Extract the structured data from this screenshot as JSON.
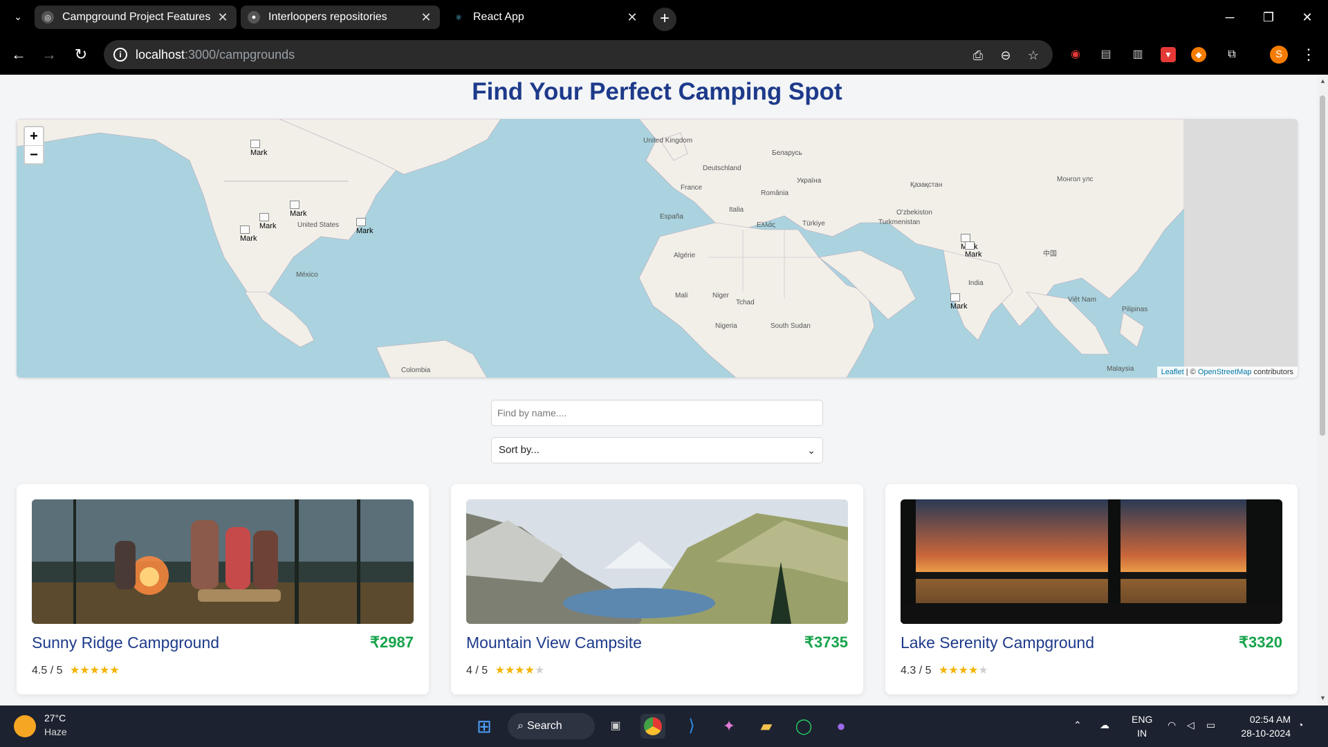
{
  "browser": {
    "tabs": [
      {
        "title": "Campground Project Features",
        "icon": "openai-icon"
      },
      {
        "title": "Interloopers repositories",
        "icon": "github-icon"
      },
      {
        "title": "React App",
        "icon": "react-icon"
      }
    ],
    "url_host": "localhost",
    "url_rest": ":3000/campgrounds",
    "profile_initial": "S"
  },
  "page": {
    "heading": "Find Your Perfect Camping Spot",
    "search_placeholder": "Find by name....",
    "sort_label": "Sort by..."
  },
  "map": {
    "zoom_in": "+",
    "zoom_out": "−",
    "marker_label": "Mark",
    "labels": [
      "United Kingdom",
      "Deutschland",
      "France",
      "España",
      "Italia",
      "România",
      "Україна",
      "Беларусь",
      "Türkiye",
      "Ελλάς",
      "Қазақстан",
      "Монгол улс",
      "O'zbekiston",
      "Turkmenistan",
      "Algérie",
      "Mali",
      "Niger",
      "Tchad",
      "Nigeria",
      "South Sudan",
      "India",
      "中国",
      "Pilipinas",
      "Việt Nam",
      "Malaysia",
      "United States",
      "México",
      "Colombia"
    ],
    "attribution": {
      "leaflet": "Leaflet",
      "sep": " | © ",
      "osm": "OpenStreetMap",
      "tail": " contributors"
    }
  },
  "campgrounds": [
    {
      "name": "Sunny Ridge Campground",
      "price": "₹2987",
      "rating_text": "4.5 / 5",
      "stars": "★★★★★",
      "stars_off": ""
    },
    {
      "name": "Mountain View Campsite",
      "price": "₹3735",
      "rating_text": "4 / 5",
      "stars": "★★★★",
      "stars_off": "★"
    },
    {
      "name": "Lake Serenity Campground",
      "price": "₹3320",
      "rating_text": "4.3 / 5",
      "stars": "★★★★",
      "stars_off": "★"
    }
  ],
  "taskbar": {
    "temperature": "27°C",
    "weather": "Haze",
    "search_label": "Search",
    "lang_1": "ENG",
    "lang_2": "IN",
    "time": "02:54 AM",
    "date": "28-10-2024"
  },
  "colors": {
    "heading": "#1d3a8a",
    "price": "#16a34a",
    "star": "#f5b301",
    "map_water": "#aad3df",
    "map_land": "#f2efe9"
  }
}
